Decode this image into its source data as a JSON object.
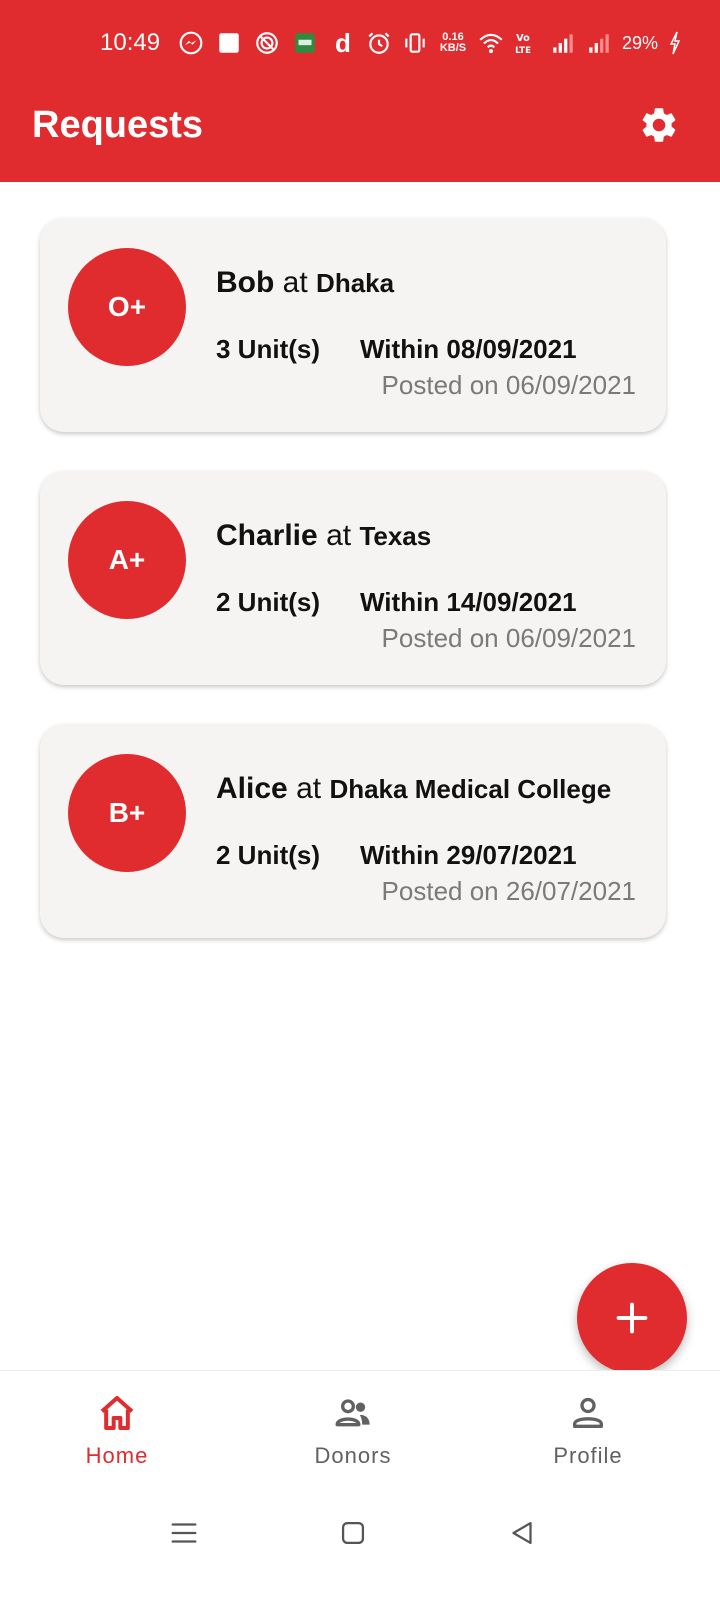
{
  "colors": {
    "accent": "#e02b2f",
    "card_bg": "#f6f4f2",
    "muted_text": "#7a7a7a",
    "inactive_nav": "#616161"
  },
  "status_bar": {
    "time": "10:49",
    "net_speed_value": "0.16",
    "net_speed_unit": "KB/S",
    "battery": "29%",
    "icons": [
      "messenger-icon",
      "square-notification-icon",
      "app-notification-icon",
      "bkash-icon",
      "d-app-icon",
      "alarm-icon",
      "vibrate-icon",
      "wifi-icon",
      "volte-icon",
      "signal-icon",
      "signal-icon",
      "charging-icon"
    ],
    "d_letter": "d"
  },
  "app_bar": {
    "title": "Requests",
    "settings_icon": "gear-icon"
  },
  "requests": [
    {
      "blood_group": "O+",
      "name": "Bob",
      "at": "at",
      "place": "Dhaka",
      "units": "3 Unit(s)",
      "within": "Within 08/09/2021",
      "posted": "Posted on 06/09/2021"
    },
    {
      "blood_group": "A+",
      "name": "Charlie",
      "at": "at",
      "place": "Texas",
      "units": "2 Unit(s)",
      "within": "Within 14/09/2021",
      "posted": "Posted on 06/09/2021"
    },
    {
      "blood_group": "B+",
      "name": "Alice",
      "at": "at",
      "place": "Dhaka Medical College",
      "units": "2 Unit(s)",
      "within": "Within 29/07/2021",
      "posted": "Posted on 26/07/2021"
    }
  ],
  "fab": {
    "icon": "plus-icon"
  },
  "bottom_nav": {
    "items": [
      {
        "label": "Home",
        "icon": "home-icon",
        "active": true
      },
      {
        "label": "Donors",
        "icon": "people-icon",
        "active": false
      },
      {
        "label": "Profile",
        "icon": "person-icon",
        "active": false
      }
    ]
  },
  "system_nav": {
    "icons": [
      "menu-icon",
      "home-square-icon",
      "back-icon"
    ]
  }
}
